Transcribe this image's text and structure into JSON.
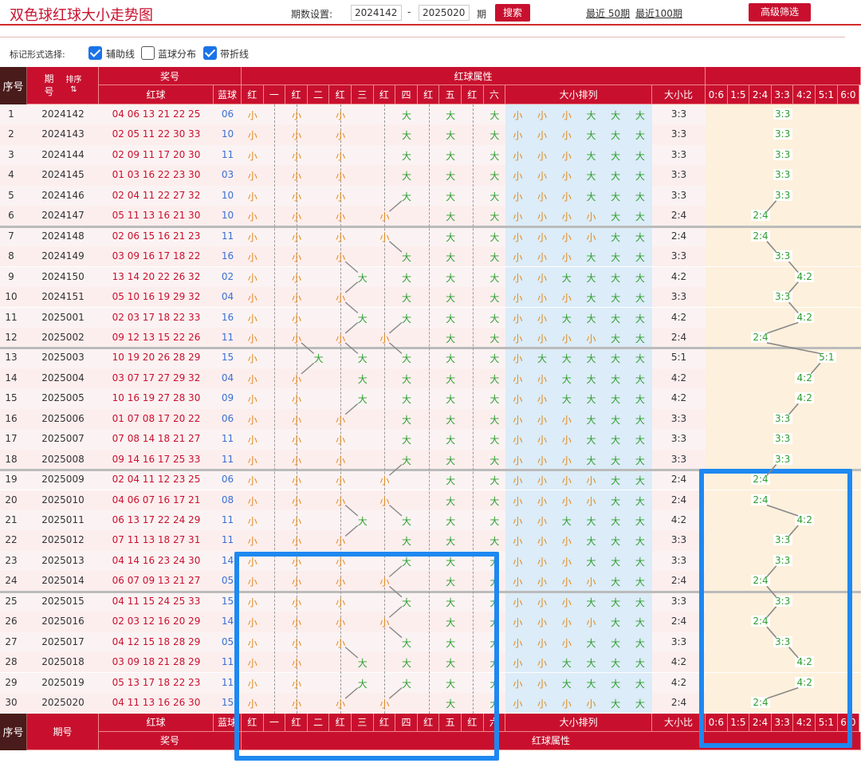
{
  "page": {
    "title": "双色球红球大小走势图",
    "period_label": "期数设置:",
    "period_from": "2024142",
    "period_dash": "-",
    "period_to": "2025020",
    "period_unit": "期",
    "search_label": "搜索",
    "recent50": "最近 50期",
    "recent100": "最近100期",
    "advanced_label": "高级筛选"
  },
  "options": {
    "label": "标记形式选择:",
    "items": [
      {
        "label": "辅助线",
        "checked": true
      },
      {
        "label": "蓝球分布",
        "checked": false
      },
      {
        "label": "带折线",
        "checked": true
      }
    ]
  },
  "header": {
    "seq": "序号",
    "period": "期号",
    "sort": "排序",
    "prize": "奖号",
    "red": "红球",
    "blue": "蓝球",
    "red_attr": "红球属性",
    "positions": [
      "红",
      "一",
      "红",
      "二",
      "红",
      "三",
      "红",
      "四",
      "红",
      "五",
      "红",
      "六"
    ],
    "size_order": "大小排列",
    "ratio_title": "大小比",
    "ratio_cols": [
      "0:6",
      "1:5",
      "2:4",
      "3:3",
      "4:2",
      "5:1",
      "6:0"
    ],
    "big": "大",
    "small": "小"
  },
  "rows": [
    {
      "seq": "1",
      "period": "2024142",
      "red": "04 06 13 21 22 25",
      "blue": "06",
      "pos": "SSSBBB",
      "ratio": "3:3"
    },
    {
      "seq": "2",
      "period": "2024143",
      "red": "02 05 11 22 30 33",
      "blue": "10",
      "pos": "SSSBBB",
      "ratio": "3:3"
    },
    {
      "seq": "3",
      "period": "2024144",
      "red": "02 09 11 17 20 30",
      "blue": "11",
      "pos": "SSSBBB",
      "ratio": "3:3"
    },
    {
      "seq": "4",
      "period": "2024145",
      "red": "01 03 16 22 23 30",
      "blue": "03",
      "pos": "SSSBBB",
      "ratio": "3:3"
    },
    {
      "seq": "5",
      "period": "2024146",
      "red": "02 04 11 22 27 32",
      "blue": "10",
      "pos": "SSSBBB",
      "ratio": "3:3"
    },
    {
      "seq": "6",
      "period": "2024147",
      "red": "05 11 13 16 21 30",
      "blue": "10",
      "pos": "SSSSBB",
      "ratio": "2:4"
    },
    {
      "seq": "7",
      "period": "2024148",
      "red": "02 06 15 16 21 23",
      "blue": "11",
      "pos": "SSSSBB",
      "ratio": "2:4"
    },
    {
      "seq": "8",
      "period": "2024149",
      "red": "03 09 16 17 18 22",
      "blue": "16",
      "pos": "SSSBBB",
      "ratio": "3:3"
    },
    {
      "seq": "9",
      "period": "2024150",
      "red": "13 14 20 22 26 32",
      "blue": "02",
      "pos": "SSBBBB",
      "ratio": "4:2"
    },
    {
      "seq": "10",
      "period": "2024151",
      "red": "05 10 16 19 29 32",
      "blue": "04",
      "pos": "SSSBBB",
      "ratio": "3:3"
    },
    {
      "seq": "11",
      "period": "2025001",
      "red": "02 03 17 18 22 33",
      "blue": "16",
      "pos": "SSBBBB",
      "ratio": "4:2"
    },
    {
      "seq": "12",
      "period": "2025002",
      "red": "09 12 13 15 22 26",
      "blue": "11",
      "pos": "SSSSBB",
      "ratio": "2:4"
    },
    {
      "seq": "13",
      "period": "2025003",
      "red": "10 19 20 26 28 29",
      "blue": "15",
      "pos": "SBBBBB",
      "ratio": "5:1"
    },
    {
      "seq": "14",
      "period": "2025004",
      "red": "03 07 17 27 29 32",
      "blue": "04",
      "pos": "SSBBBB",
      "ratio": "4:2"
    },
    {
      "seq": "15",
      "period": "2025005",
      "red": "10 16 19 27 28 30",
      "blue": "09",
      "pos": "SSBBBB",
      "ratio": "4:2"
    },
    {
      "seq": "16",
      "period": "2025006",
      "red": "01 07 08 17 20 22",
      "blue": "06",
      "pos": "SSSBBB",
      "ratio": "3:3"
    },
    {
      "seq": "17",
      "period": "2025007",
      "red": "07 08 14 18 21 27",
      "blue": "11",
      "pos": "SSSBBB",
      "ratio": "3:3"
    },
    {
      "seq": "18",
      "period": "2025008",
      "red": "09 14 16 17 25 33",
      "blue": "11",
      "pos": "SSSBBB",
      "ratio": "3:3"
    },
    {
      "seq": "19",
      "period": "2025009",
      "red": "02 04 11 12 23 25",
      "blue": "06",
      "pos": "SSSSBB",
      "ratio": "2:4"
    },
    {
      "seq": "20",
      "period": "2025010",
      "red": "04 06 07 16 17 21",
      "blue": "08",
      "pos": "SSSSBB",
      "ratio": "2:4"
    },
    {
      "seq": "21",
      "period": "2025011",
      "red": "06 13 17 22 24 29",
      "blue": "11",
      "pos": "SSBBBB",
      "ratio": "4:2"
    },
    {
      "seq": "22",
      "period": "2025012",
      "red": "07 11 13 18 27 31",
      "blue": "11",
      "pos": "SSSBBB",
      "ratio": "3:3"
    },
    {
      "seq": "23",
      "period": "2025013",
      "red": "04 14 16 23 24 30",
      "blue": "14",
      "pos": "SSSBBB",
      "ratio": "3:3"
    },
    {
      "seq": "24",
      "period": "2025014",
      "red": "06 07 09 13 21 27",
      "blue": "05",
      "pos": "SSSSBB",
      "ratio": "2:4"
    },
    {
      "seq": "25",
      "period": "2025015",
      "red": "04 11 15 24 25 33",
      "blue": "15",
      "pos": "SSSBBB",
      "ratio": "3:3"
    },
    {
      "seq": "26",
      "period": "2025016",
      "red": "02 03 12 16 20 29",
      "blue": "14",
      "pos": "SSSSBB",
      "ratio": "2:4"
    },
    {
      "seq": "27",
      "period": "2025017",
      "red": "04 12 15 18 28 29",
      "blue": "05",
      "pos": "SSSBBB",
      "ratio": "3:3"
    },
    {
      "seq": "28",
      "period": "2025018",
      "red": "03 09 18 21 28 29",
      "blue": "11",
      "pos": "SSBBBB",
      "ratio": "4:2"
    },
    {
      "seq": "29",
      "period": "2025019",
      "red": "05 13 17 18 22 23",
      "blue": "11",
      "pos": "SSBBBB",
      "ratio": "4:2"
    },
    {
      "seq": "30",
      "period": "2025020",
      "red": "04 11 13 16 26 30",
      "blue": "15",
      "pos": "SSSSBB",
      "ratio": "2:4"
    }
  ],
  "colors": {
    "brand_red": "#c8102e",
    "big": "#2e9e2e",
    "small": "#e08a1e",
    "blue_num": "#3b6fd1",
    "highlight": "#1e88f0"
  }
}
